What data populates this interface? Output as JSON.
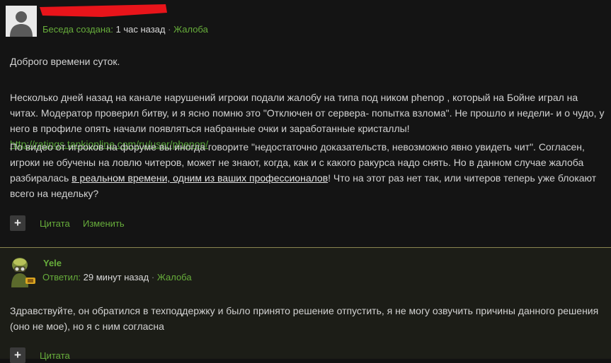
{
  "post1": {
    "meta": {
      "created_label": "Беседа создана:",
      "time": "1 час назад",
      "sep": "·",
      "report": "Жалоба"
    },
    "greeting": "Доброго времени суток.",
    "p1_text": "Несколько дней назад на канале нарушений игроки подали жалобу на типа под ником phenop , который на Бойне играл на читах. Модератор проверил битву, и я ясно помню это \"Отключен от сервера- попытка взлома\". Не прошло и недели- и о чудо, у него в профиле опять начали появляться набранные очки и заработанные кристаллы! ",
    "p1_link": "http://ratings.tankionline.com/ru/user/phenop/",
    "p2_text1": "По видео от игроков на форуме вы иногда говорите \"недостаточно доказательств, невозможно явно увидеть чит\". Согласен, игроки не обучены на ловлю читеров, может не знают, когда, как и с какого ракурса надо снять. Но в данном случае жалоба разбиралась ",
    "p2_underlined": "в реальном времени, одним из ваших профессионалов",
    "p2_text2": "! Что на этот раз нет так, или читеров теперь уже блокают всего на недельку?",
    "actions": {
      "plus": "+",
      "quote": "Цитата",
      "edit": "Изменить"
    }
  },
  "post2": {
    "author": "Yele",
    "meta": {
      "replied_label": "Ответил:",
      "time": "29 минут назад",
      "sep": "·",
      "report": "Жалоба"
    },
    "body": "Здравствуйте, он обратился в техподдержку и было принято решение отпустить, я не могу озвучить причины данного  решения (оно не мое), но я с ним согласна",
    "actions": {
      "plus": "+",
      "quote": "Цитата"
    }
  },
  "colors": {
    "accent_green": "#67ad3b",
    "link_green": "#58a63a",
    "divider": "#8a8450",
    "redaction": "#e8141a"
  },
  "icons": {
    "avatar1": "default-user-silhouette-icon",
    "avatar2": "tank-helmet-rank-icon"
  }
}
